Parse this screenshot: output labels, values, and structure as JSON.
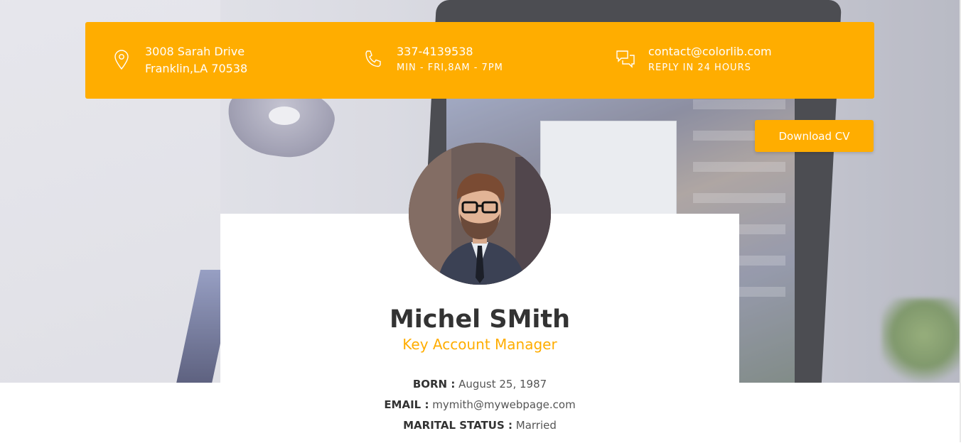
{
  "contact": {
    "address": {
      "line1": "3008 Sarah Drive",
      "line2": "Franklin,LA 70538",
      "icon": "map-pin-icon"
    },
    "phone": {
      "line1": "337-4139538",
      "line2": "MIN - FRI,8AM - 7PM",
      "icon": "phone-icon"
    },
    "email": {
      "line1": "contact@colorlib.com",
      "line2": "REPLY IN 24 HOURS",
      "icon": "chat-bubbles-icon"
    }
  },
  "download_label": "Download CV",
  "profile": {
    "name": "Michel SMith",
    "title": "Key Account Manager",
    "born_label": "BORN :",
    "born_value": "August 25, 1987",
    "email_label": "EMAIL :",
    "email_value": "mymith@mywebpage.com",
    "marital_label": "MARITAL STATUS :",
    "marital_value": "Married"
  },
  "colors": {
    "accent": "#ffad00",
    "text_dark": "#333333",
    "text_body": "#555555"
  }
}
